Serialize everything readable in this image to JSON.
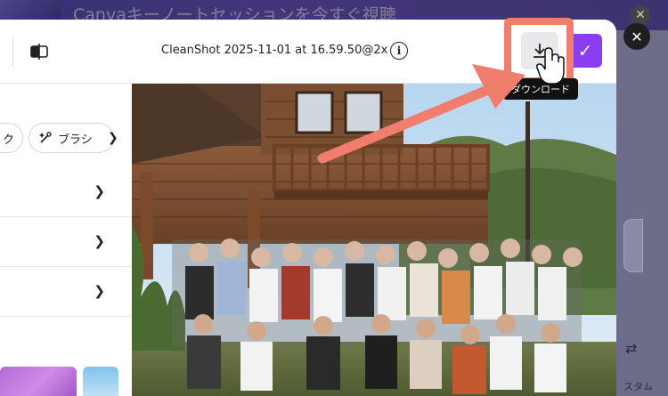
{
  "background": {
    "banner_text": "Canvaキーノートセッションを今すぐ視聴",
    "right_panel_text": "スタム"
  },
  "header": {
    "filename": "CleanShot 2025-11-01 at 16.59.50@2x",
    "info_label": "i",
    "confirm_icon": "check-icon",
    "download_icon": "download-icon",
    "compare_icon": "compare-icon"
  },
  "tooltip": {
    "text": "ダウンロード"
  },
  "sidebar": {
    "chips": [
      {
        "label": "ク"
      },
      {
        "label": "ブラシ",
        "icon": "magic-brush-icon"
      }
    ],
    "rows": [
      {
        "label": ""
      },
      {
        "label": ""
      },
      {
        "label": ""
      }
    ]
  },
  "colors": {
    "accent_purple": "#8b3df2",
    "highlight_coral": "#f07d6e"
  }
}
